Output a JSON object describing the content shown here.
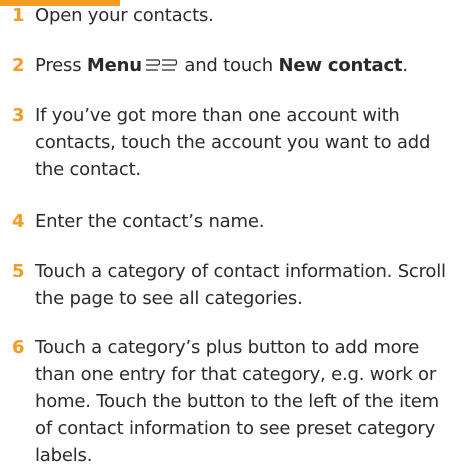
{
  "steps": [
    {
      "number": "1",
      "text": "Open your contacts."
    },
    {
      "number": "2",
      "text_before": "Press ",
      "bold_menu": "Menu",
      "text_middle": " and touch ",
      "bold_new_contact": "New contact",
      "text_after": "."
    },
    {
      "number": "3",
      "text": "If you’ve got more than one account with contacts, touch the account you want to add the contact."
    },
    {
      "number": "4",
      "text": "Enter the contact’s name."
    },
    {
      "number": "5",
      "text": "Touch a category of contact information. Scroll the page to see all categories."
    },
    {
      "number": "6",
      "text": "Touch a category’s plus button to add more than one entry for that category, e.g. work or home. Touch the button to the left of the item of contact information to see preset category labels."
    }
  ],
  "colors": {
    "accent": "#f39c21",
    "text": "#2b2b2b"
  },
  "icons": [
    "menu-icon"
  ]
}
